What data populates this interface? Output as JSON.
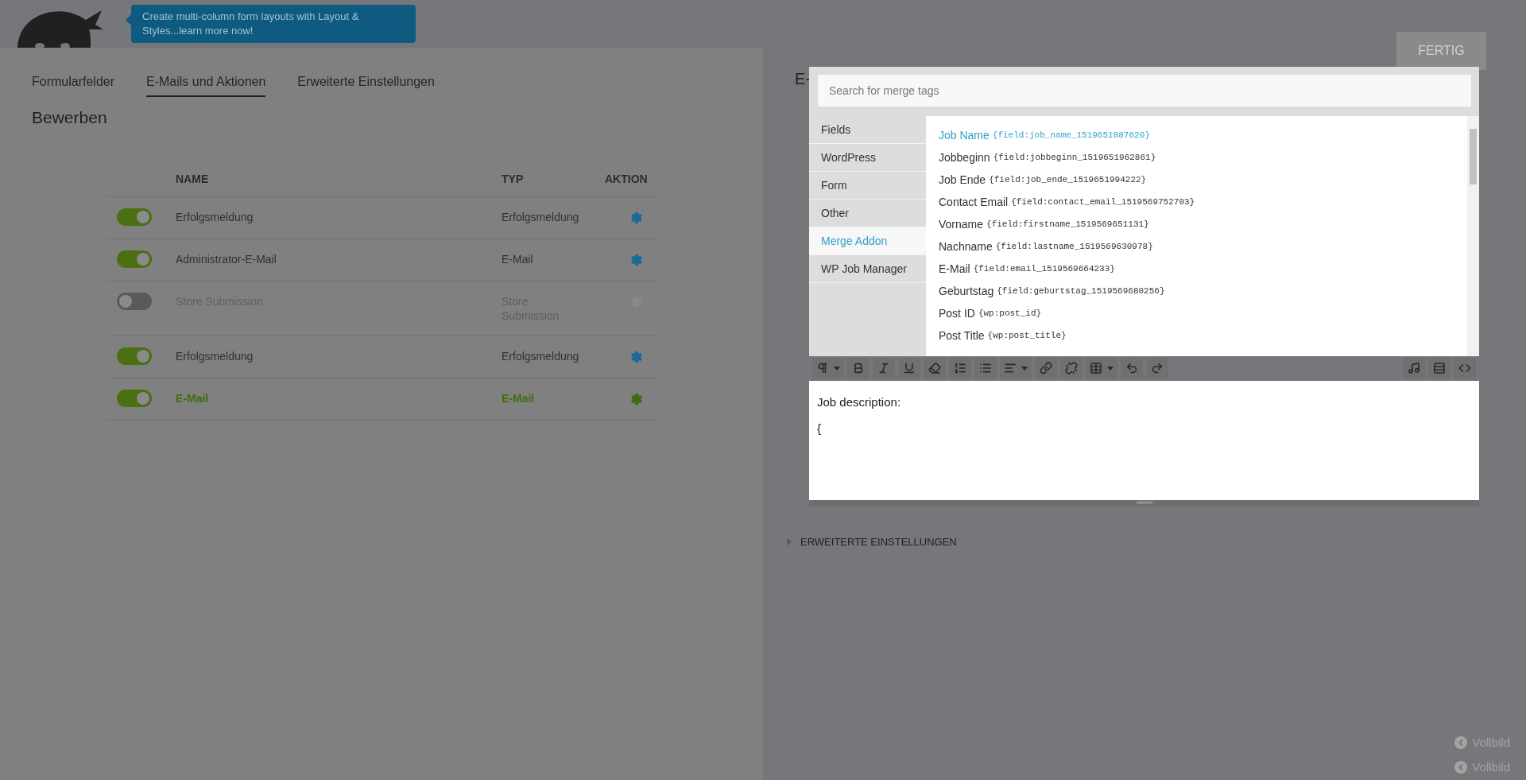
{
  "promo": {
    "text": "Create multi-column form layouts with Layout & Styles...learn more now!"
  },
  "tabs": [
    {
      "label": "Formularfelder",
      "selected": false
    },
    {
      "label": "E-Mails und Aktionen",
      "selected": true
    },
    {
      "label": "Erweiterte Einstellungen",
      "selected": false
    }
  ],
  "form_title": "Bewerben",
  "table": {
    "columns": [
      "NAME",
      "TYP",
      "AKTION"
    ],
    "rows": [
      {
        "on": true,
        "selected": false,
        "name": "Erfolgsmeldung",
        "type": "Erfolgsmeldung"
      },
      {
        "on": true,
        "selected": false,
        "name": "Administrator-E-Mail",
        "type": "E-Mail"
      },
      {
        "on": false,
        "selected": false,
        "name": "Store Submission",
        "type": "Store Submission"
      },
      {
        "on": true,
        "selected": false,
        "name": "Erfolgsmeldung",
        "type": "Erfolgsmeldung"
      },
      {
        "on": true,
        "selected": true,
        "name": "E-Mail",
        "type": "E-Mail"
      }
    ]
  },
  "done_button": "FERTIG",
  "panel_heading": "E-",
  "merge_tags": {
    "placeholder": "Search for merge tags",
    "categories": [
      {
        "label": "Fields",
        "selected": false
      },
      {
        "label": "WordPress",
        "selected": false
      },
      {
        "label": "Form",
        "selected": false
      },
      {
        "label": "Other",
        "selected": false
      },
      {
        "label": "Merge Addon",
        "selected": true
      },
      {
        "label": "WP Job Manager",
        "selected": false
      }
    ],
    "tags": [
      {
        "label": "Job Name",
        "tag": "{field:job_name_1519651887620}",
        "selected": true
      },
      {
        "label": "Jobbeginn",
        "tag": "{field:jobbeginn_1519651962861}",
        "selected": false
      },
      {
        "label": "Job Ende",
        "tag": "{field:job_ende_1519651994222}",
        "selected": false
      },
      {
        "label": "Contact Email",
        "tag": "{field:contact_email_1519569752703}",
        "selected": false
      },
      {
        "label": "Vorname",
        "tag": "{field:firstname_1519569651131}",
        "selected": false
      },
      {
        "label": "Nachname",
        "tag": "{field:lastname_1519569630978}",
        "selected": false
      },
      {
        "label": "E-Mail",
        "tag": "{field:email_1519569664233}",
        "selected": false
      },
      {
        "label": "Geburtstag",
        "tag": "{field:geburtstag_1519569680256}",
        "selected": false
      },
      {
        "label": "Post ID",
        "tag": "{wp:post_id}",
        "selected": false
      },
      {
        "label": "Post Title",
        "tag": "{wp:post_title}",
        "selected": false
      }
    ]
  },
  "editor": {
    "paragraphs": [
      "Job description:",
      "{"
    ]
  },
  "advanced_settings": "ERWEITERTE EINSTELLUNGEN",
  "fullscreen_links": [
    "Vollbild",
    "Vollbild"
  ]
}
